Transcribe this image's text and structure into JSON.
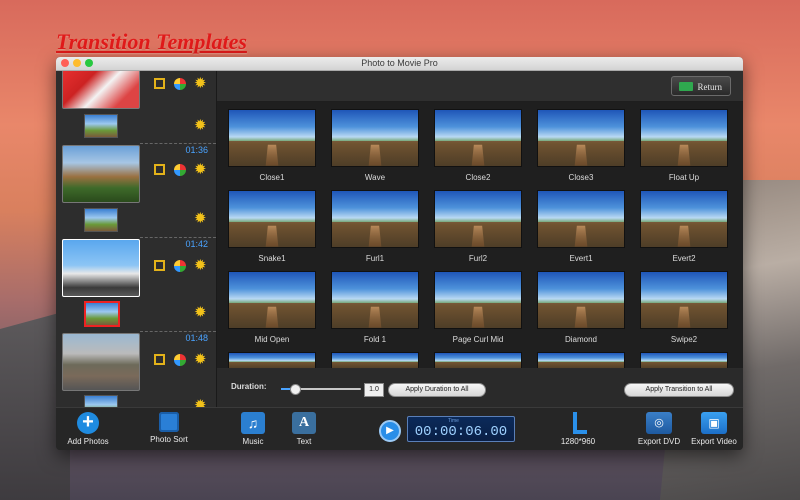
{
  "page_heading": "Transition Templates",
  "window": {
    "title": "Photo to Movie Pro"
  },
  "sidebar": {
    "slides": [
      {
        "time": ""
      },
      {
        "time": "01:36"
      },
      {
        "time": "01:42"
      },
      {
        "time": "01:48"
      }
    ]
  },
  "toolbar_top": {
    "return_label": "Return"
  },
  "transitions": [
    "Close1",
    "Wave",
    "Close2",
    "Close3",
    "Float Up",
    "Snake1",
    "Furl1",
    "Furl2",
    "Evert1",
    "Evert2",
    "Mid Open",
    "Fold 1",
    "Page Curl Mid",
    "Diamond",
    "Swipe2"
  ],
  "duration": {
    "label": "Duration:",
    "value": "1.0",
    "level": 0.18,
    "apply_duration_label": "Apply Duration to All",
    "apply_transition_label": "Apply Transition to All"
  },
  "bottom": {
    "add_photos": "Add Photos",
    "photo_sort": "Photo Sort",
    "music": "Music",
    "text": "Text",
    "timecode_label": "Time",
    "timecode": "00:00:06.00",
    "resolution": "1280*960",
    "export_dvd": "Export DVD",
    "export_video": "Export Video"
  },
  "icons": {
    "play": "play-icon",
    "gear": "gear-icon",
    "crop": "crop-icon",
    "effects": "effects-icon",
    "return": "return-icon"
  },
  "colors": {
    "heading": "#e11a1a",
    "accent": "#4aa3ff",
    "gear": "#f2c21a"
  }
}
